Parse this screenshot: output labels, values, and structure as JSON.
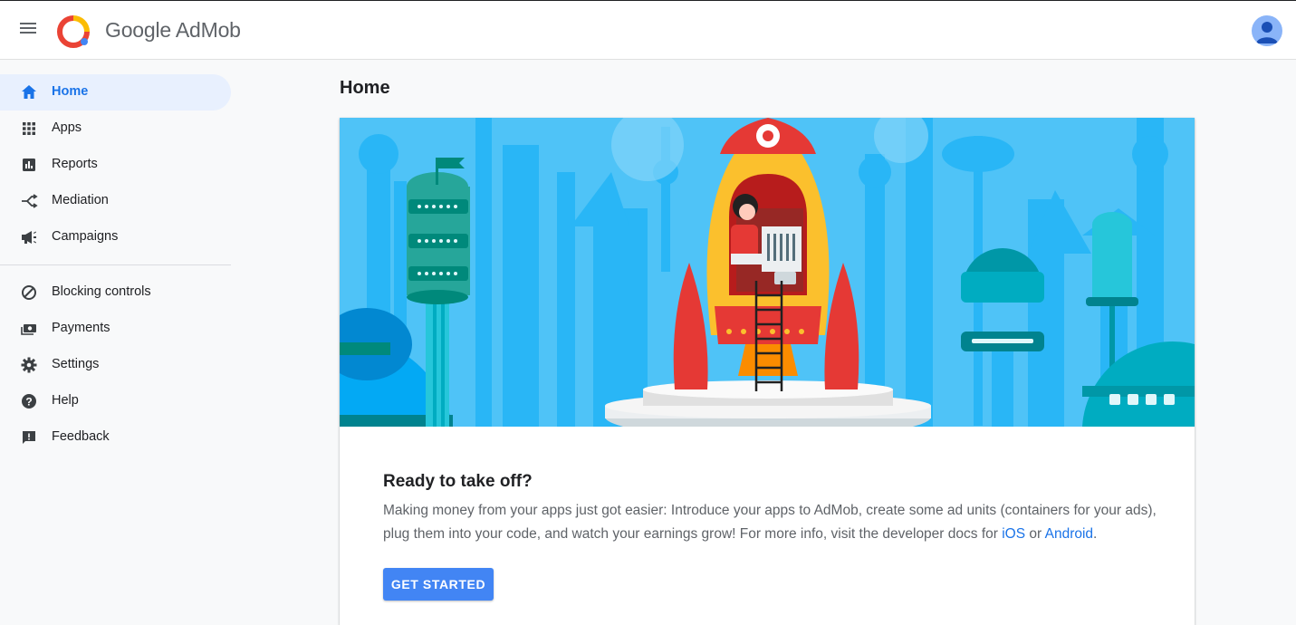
{
  "app": {
    "brand_name": "Google AdMob"
  },
  "sidebar": {
    "items": [
      {
        "label": "Home",
        "icon": "home-icon",
        "active": true
      },
      {
        "label": "Apps",
        "icon": "apps-grid-icon",
        "active": false
      },
      {
        "label": "Reports",
        "icon": "reports-icon",
        "active": false
      },
      {
        "label": "Mediation",
        "icon": "mediation-icon",
        "active": false
      },
      {
        "label": "Campaigns",
        "icon": "megaphone-icon",
        "active": false
      },
      {
        "label": "Blocking controls",
        "icon": "block-icon",
        "active": false
      },
      {
        "label": "Payments",
        "icon": "payments-icon",
        "active": false
      },
      {
        "label": "Settings",
        "icon": "gear-icon",
        "active": false
      },
      {
        "label": "Help",
        "icon": "help-icon",
        "active": false
      },
      {
        "label": "Feedback",
        "icon": "feedback-icon",
        "active": false
      }
    ]
  },
  "main": {
    "page_title": "Home",
    "card": {
      "title": "Ready to take off?",
      "body_text": "Making money from your apps just got easier: Introduce your apps to AdMob, create some ad units (containers for your ads), plug them into your code, and watch your earnings grow! For more info, visit the developer docs for ",
      "link_ios": "iOS",
      "link_connector": " or ",
      "link_android": "Android",
      "body_end": ".",
      "button_label": "GET STARTED"
    }
  },
  "colors": {
    "accent": "#1a73e8",
    "button": "#4285f4",
    "active_nav_bg": "#e8f0fe",
    "hero_sky": "#4fc3f7",
    "rocket_red": "#e53935",
    "rocket_yellow": "#fbc02d"
  }
}
